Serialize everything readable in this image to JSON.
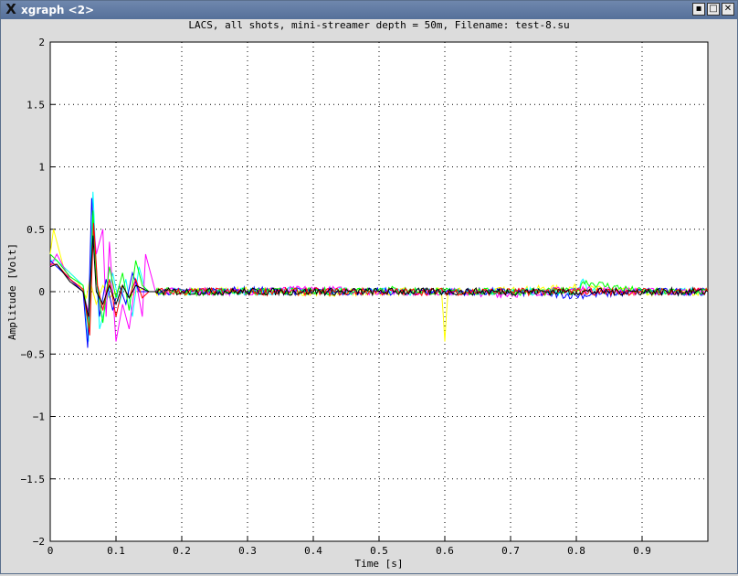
{
  "window": {
    "title": "xgraph <2>",
    "app_icon": "x-logo-icon",
    "controls": [
      "minimize-icon",
      "maximize-icon",
      "close-icon"
    ]
  },
  "chart_data": {
    "type": "line",
    "title": "LACS, all shots, mini-streamer depth = 50m, Filename: test-8.su",
    "xlabel": "Time [s]",
    "ylabel": "Amplitude [Volt]",
    "xlim": [
      0,
      1
    ],
    "ylim": [
      -2,
      2
    ],
    "x_ticks": [
      0,
      0.1,
      0.2,
      0.3,
      0.4,
      0.5,
      0.6,
      0.7,
      0.8,
      0.9
    ],
    "x_tick_labels": [
      "0",
      "0.1",
      "0.2",
      "0.3",
      "0.4",
      "0.5",
      "0.6",
      "0.7",
      "0.8",
      "0.9"
    ],
    "y_ticks": [
      2,
      1.5,
      1,
      0.5,
      0,
      -0.5,
      -1,
      -1.5,
      -2
    ],
    "y_tick_labels": [
      "2",
      "1.5",
      "1",
      "0.5",
      "0",
      "−0.5",
      "−1",
      "−1.5",
      "−2"
    ],
    "grid": true,
    "background": "#ffffff",
    "series_colors": [
      "#ffff00",
      "#00ffff",
      "#ff00ff",
      "#0000ff",
      "#00ff00",
      "#ff0000",
      "#000000"
    ],
    "series": [
      {
        "x": [
          0,
          0.005,
          0.02,
          0.04,
          0.055,
          0.06,
          0.065,
          0.07,
          0.08,
          0.09,
          0.1,
          0.11,
          0.12,
          0.13,
          0.14,
          0.15,
          0.2,
          0.3,
          0.4,
          0.5,
          0.595,
          0.6,
          0.605,
          0.7,
          0.8,
          0.9,
          1.0
        ],
        "y": [
          0.3,
          0.5,
          0.2,
          0.1,
          -0.05,
          0.1,
          0.0,
          -0.1,
          0.05,
          -0.05,
          0.0,
          0.05,
          -0.05,
          0.0,
          0.02,
          0.0,
          0.0,
          0.01,
          -0.01,
          0.0,
          0.0,
          -0.4,
          0.0,
          0.01,
          0.03,
          -0.01,
          0.0
        ]
      },
      {
        "x": [
          0,
          0.01,
          0.03,
          0.05,
          0.058,
          0.065,
          0.07,
          0.075,
          0.085,
          0.095,
          0.105,
          0.115,
          0.125,
          0.135,
          0.145,
          0.16,
          0.2,
          0.3,
          0.4,
          0.5,
          0.6,
          0.7,
          0.8,
          0.81,
          0.82,
          0.9,
          1.0
        ],
        "y": [
          0.25,
          0.25,
          0.15,
          0.05,
          -0.4,
          0.8,
          0.2,
          -0.3,
          -0.1,
          0.15,
          -0.1,
          0.1,
          -0.2,
          0.2,
          0.0,
          0.0,
          0.0,
          0.0,
          0.01,
          0.0,
          0.0,
          0.0,
          0.0,
          0.1,
          0.0,
          0.0,
          0.0
        ]
      },
      {
        "x": [
          0,
          0.01,
          0.03,
          0.05,
          0.06,
          0.065,
          0.07,
          0.08,
          0.085,
          0.09,
          0.1,
          0.11,
          0.12,
          0.13,
          0.14,
          0.145,
          0.16,
          0.2,
          0.3,
          0.4,
          0.5,
          0.6,
          0.7,
          0.8,
          0.9,
          1.0
        ],
        "y": [
          0.2,
          0.3,
          0.1,
          0.0,
          -0.2,
          0.6,
          0.3,
          0.5,
          -0.2,
          0.4,
          -0.4,
          -0.1,
          -0.3,
          0.1,
          -0.2,
          0.3,
          0.0,
          0.0,
          0.0,
          0.02,
          0.0,
          0.0,
          -0.02,
          0.02,
          0.0,
          0.0
        ]
      },
      {
        "x": [
          0,
          0.01,
          0.03,
          0.05,
          0.057,
          0.063,
          0.068,
          0.075,
          0.085,
          0.095,
          0.105,
          0.115,
          0.125,
          0.135,
          0.15,
          0.2,
          0.3,
          0.4,
          0.5,
          0.6,
          0.7,
          0.8,
          0.9,
          1.0
        ],
        "y": [
          0.25,
          0.2,
          0.1,
          0.0,
          -0.45,
          0.75,
          0.3,
          -0.2,
          0.1,
          -0.15,
          0.05,
          -0.1,
          0.15,
          0.0,
          0.0,
          0.0,
          0.01,
          0.0,
          0.0,
          0.0,
          0.0,
          -0.03,
          0.0,
          0.0
        ]
      },
      {
        "x": [
          0,
          0.01,
          0.03,
          0.05,
          0.06,
          0.065,
          0.07,
          0.08,
          0.09,
          0.1,
          0.11,
          0.12,
          0.13,
          0.14,
          0.15,
          0.2,
          0.3,
          0.4,
          0.5,
          0.6,
          0.7,
          0.8,
          0.81,
          0.9,
          1.0
        ],
        "y": [
          0.3,
          0.25,
          0.12,
          0.05,
          -0.3,
          0.65,
          0.1,
          -0.25,
          0.2,
          -0.05,
          0.15,
          -0.15,
          0.25,
          0.05,
          0.0,
          0.0,
          0.0,
          0.0,
          0.02,
          0.0,
          0.0,
          0.0,
          0.08,
          0.0,
          0.0
        ]
      },
      {
        "x": [
          0,
          0.01,
          0.03,
          0.05,
          0.06,
          0.066,
          0.072,
          0.08,
          0.09,
          0.1,
          0.11,
          0.12,
          0.13,
          0.14,
          0.15,
          0.2,
          0.3,
          0.4,
          0.5,
          0.6,
          0.7,
          0.8,
          0.9,
          1.0
        ],
        "y": [
          0.22,
          0.22,
          0.1,
          0.02,
          -0.35,
          0.55,
          0.05,
          -0.15,
          0.1,
          -0.2,
          0.05,
          -0.05,
          0.1,
          -0.05,
          0.0,
          0.0,
          0.0,
          0.0,
          0.0,
          0.0,
          0.0,
          0.0,
          0.0,
          0.0
        ]
      },
      {
        "x": [
          0,
          0.01,
          0.03,
          0.05,
          0.058,
          0.065,
          0.07,
          0.08,
          0.09,
          0.1,
          0.11,
          0.12,
          0.13,
          0.15,
          0.2,
          0.3,
          0.4,
          0.5,
          0.6,
          0.7,
          0.8,
          0.9,
          1.0
        ],
        "y": [
          0.2,
          0.22,
          0.08,
          0.0,
          -0.2,
          0.45,
          0.0,
          -0.1,
          0.05,
          -0.1,
          0.05,
          -0.05,
          0.05,
          0.0,
          0.0,
          0.0,
          0.0,
          0.0,
          0.0,
          0.0,
          0.0,
          0.0,
          0.0
        ]
      }
    ]
  }
}
